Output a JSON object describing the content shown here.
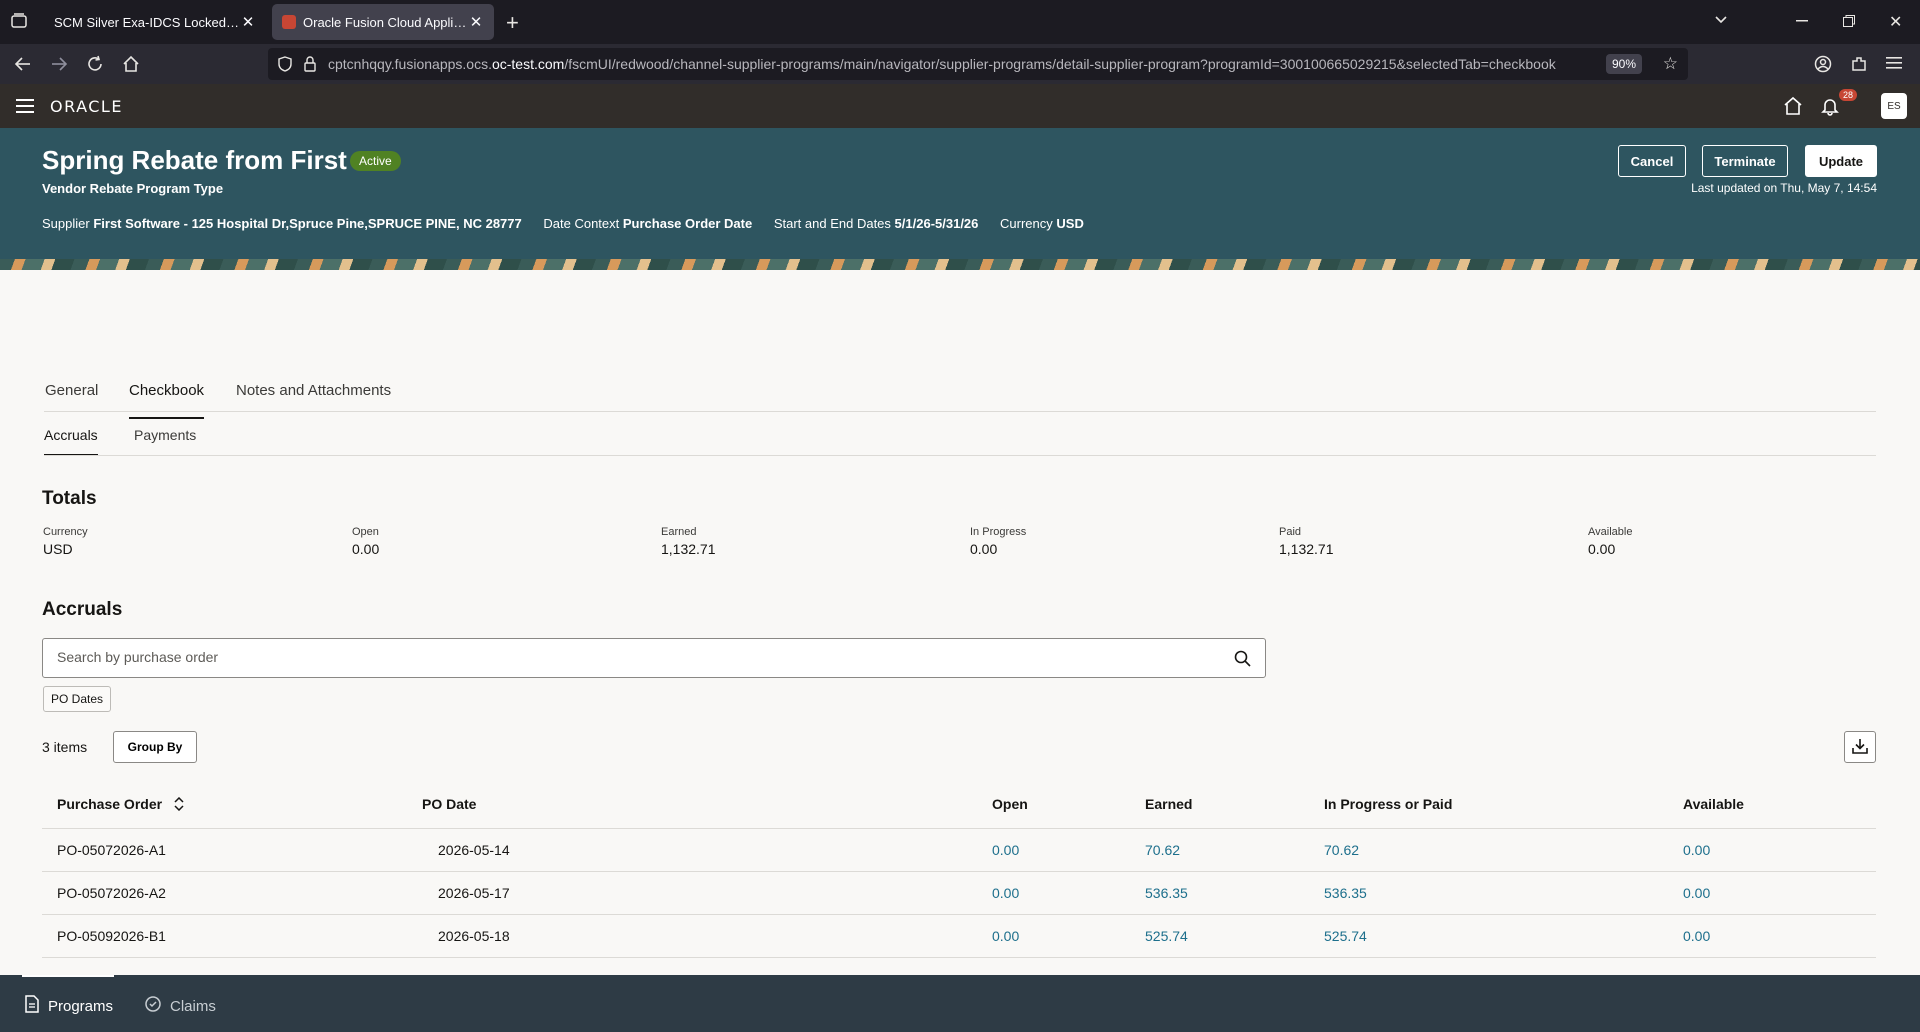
{
  "browser": {
    "tabs": [
      {
        "title": "SCM Silver Exa-IDCS Locked Opt-In",
        "active": false
      },
      {
        "title": "Oracle Fusion Cloud Applications",
        "active": true
      }
    ],
    "url_pre": "cptcnhqqy.fusionapps.ocs.",
    "url_domain": "oc-test.com",
    "url_post": "/fscmUI/redwood/channel-supplier-programs/main/navigator/supplier-programs/detail-supplier-program?programId=300100665029215&selectedTab=checkbook",
    "zoom": "90%"
  },
  "app": {
    "brand": "ORACLE",
    "notifications": "28",
    "user_initials": "ES"
  },
  "program": {
    "title": "Spring Rebate from First",
    "status": "Active",
    "type": "Vendor Rebate Program Type",
    "supplier_label": "Supplier",
    "supplier_value": "First Software - 125 Hospital Dr,Spruce Pine,SPRUCE PINE, NC 28777",
    "date_context_label": "Date Context",
    "date_context_value": "Purchase Order Date",
    "dates_label": "Start and End Dates",
    "dates_value": "5/1/26-5/31/26",
    "currency_label": "Currency",
    "currency_value": "USD",
    "last_updated": "Last updated on Thu, May 7, 14:54",
    "buttons": {
      "cancel": "Cancel",
      "terminate": "Terminate",
      "update": "Update"
    }
  },
  "tabs": {
    "general": "General",
    "checkbook": "Checkbook",
    "notes": "Notes and Attachments",
    "accruals": "Accruals",
    "payments": "Payments"
  },
  "totals": {
    "heading": "Totals",
    "currency_label": "Currency",
    "currency": "USD",
    "open_label": "Open",
    "open": "0.00",
    "earned_label": "Earned",
    "earned": "1,132.71",
    "inprogress_label": "In Progress",
    "inprogress": "0.00",
    "paid_label": "Paid",
    "paid": "1,132.71",
    "available_label": "Available",
    "available": "0.00"
  },
  "accruals": {
    "heading": "Accruals",
    "search_placeholder": "Search by purchase order",
    "filter_chip": "PO Dates",
    "count": "3 items",
    "group_by": "Group By",
    "columns": {
      "po": "Purchase Order",
      "po_date": "PO Date",
      "open": "Open",
      "earned": "Earned",
      "inprogress_paid": "In Progress or Paid",
      "available": "Available"
    },
    "rows": [
      {
        "po": "PO-05072026-A1",
        "date": "2026-05-14",
        "open": "0.00",
        "earned": "70.62",
        "paid": "70.62",
        "available": "0.00"
      },
      {
        "po": "PO-05072026-A2",
        "date": "2026-05-17",
        "open": "0.00",
        "earned": "536.35",
        "paid": "536.35",
        "available": "0.00"
      },
      {
        "po": "PO-05092026-B1",
        "date": "2026-05-18",
        "open": "0.00",
        "earned": "525.74",
        "paid": "525.74",
        "available": "0.00"
      }
    ]
  },
  "bottom_nav": {
    "programs": "Programs",
    "claims": "Claims"
  }
}
